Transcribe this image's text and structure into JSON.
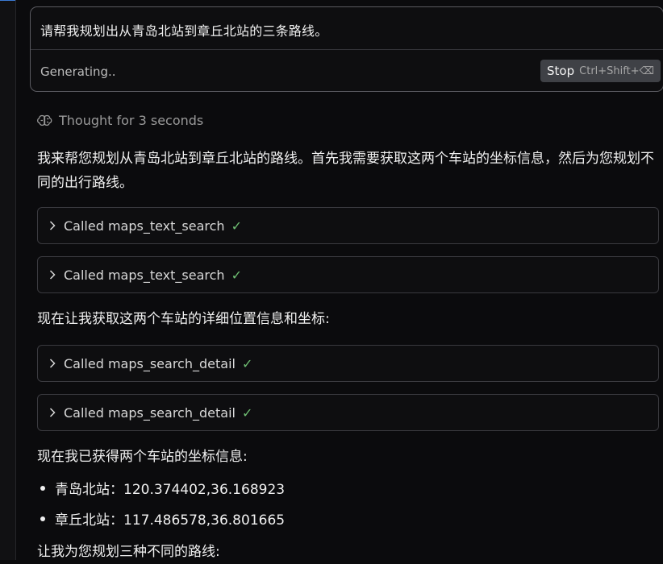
{
  "prompt": {
    "text": "请帮我规划出从青岛北站到章丘北站的三条路线。",
    "status": "Generating..",
    "stop_label": "Stop",
    "stop_shortcut": "Ctrl+Shift+⌫"
  },
  "thought": {
    "icon": "brain-icon",
    "label": "Thought for 3 seconds"
  },
  "messages": {
    "intro": "我来帮您规划从青岛北站到章丘北站的路线。首先我需要获取这两个车站的坐标信息，然后为您规划不同的出行路线。",
    "detail_intro": "现在让我获取这两个车站的详细位置信息和坐标:",
    "coords_intro": "现在我已获得两个车站的坐标信息:",
    "plan_intro": "让我为您规划三种不同的路线:"
  },
  "tool_calls": [
    {
      "label": "Called maps_text_search",
      "status_icon": "check-icon"
    },
    {
      "label": "Called maps_text_search",
      "status_icon": "check-icon"
    },
    {
      "label": "Called maps_search_detail",
      "status_icon": "check-icon"
    },
    {
      "label": "Called maps_search_detail",
      "status_icon": "check-icon"
    }
  ],
  "stations": [
    {
      "text": "青岛北站：120.374402,36.168923"
    },
    {
      "text": "章丘北站：117.486578,36.801665"
    }
  ],
  "colors": {
    "background": "#0b0b0d",
    "check": "#6fbf73",
    "stop_button": "#3f4146"
  }
}
